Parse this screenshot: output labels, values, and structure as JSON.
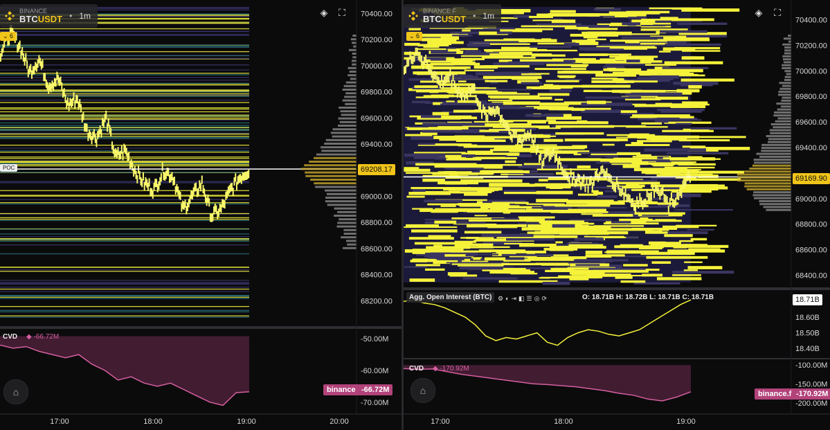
{
  "left_panel": {
    "exchange": "BINANCE",
    "symbol_base": "BTC",
    "symbol_quote": "USDT",
    "timeframe": "1m",
    "indicator_count": "6",
    "poc_label": "POC",
    "current_price": "69208.17",
    "cvd_label": "CVD",
    "cvd_value": "-66.72M",
    "cvd_exchange_tag": "binance",
    "cvd_current": "-66.72M",
    "colors": {
      "heat": "#f5f23a",
      "price_tag": "#f0c419",
      "cvd": "#b2437a"
    }
  },
  "right_panel": {
    "exchange": "BINANCE F",
    "symbol_base": "BTC",
    "symbol_quote": "USDT",
    "timeframe": "1m",
    "indicator_count": "6",
    "current_price": "69169.90",
    "oi_label": "Agg. Open Interest (BTC)",
    "oi_ohlc": "O: 18.71B  H: 18.72B  L: 18.71B  C: 18.71B",
    "oi_current": "18.71B",
    "cvd_label": "CVD",
    "cvd_value": "-170.92M",
    "cvd_exchange_tag": "binance.f",
    "cvd_current": "-170.92M"
  },
  "chart_data": [
    {
      "type": "heatmap",
      "title": "BINANCE BTCUSDT 1m",
      "y_ticks": [
        "70400.00",
        "70200.00",
        "70000.00",
        "69800.00",
        "69600.00",
        "69400.00",
        "69000.00",
        "68800.00",
        "68600.00",
        "68400.00",
        "68200.00"
      ],
      "ylim": [
        68000,
        70450
      ],
      "x_ticks": [
        "17:00",
        "18:00",
        "19:00",
        "20:00"
      ],
      "price_series": [
        70100,
        70250,
        70150,
        69950,
        70050,
        69850,
        69900,
        69700,
        69750,
        69500,
        69450,
        69600,
        69300,
        69350,
        69200,
        69100,
        69050,
        69200,
        69150,
        68900,
        69000,
        69100,
        68850,
        68900,
        69050,
        69150,
        69208.17
      ],
      "poc": 69208.17,
      "cvd": {
        "y_ticks": [
          "-50.00M",
          "-60.00M",
          "-70.00M"
        ],
        "ylim": [
          -72,
          -48
        ],
        "values": [
          -52,
          -53,
          -52.5,
          -54,
          -55,
          -56,
          -55,
          -58,
          -60,
          -63,
          -62,
          -64,
          -65,
          -64,
          -66,
          -68,
          -70,
          -71,
          -67,
          -66.72
        ]
      }
    },
    {
      "type": "heatmap",
      "title": "BINANCE F BTCUSDT 1m",
      "y_ticks": [
        "70400.00",
        "70200.00",
        "70000.00",
        "69800.00",
        "69600.00",
        "69400.00",
        "69000.00",
        "68800.00",
        "68600.00",
        "68400.00"
      ],
      "ylim": [
        68300,
        70500
      ],
      "x_ticks": [
        "17:00",
        "18:00",
        "19:00"
      ],
      "price_series": [
        70000,
        70150,
        70050,
        69900,
        69950,
        69800,
        69850,
        69650,
        69700,
        69550,
        69450,
        69500,
        69300,
        69350,
        69200,
        69150,
        69100,
        69200,
        69150,
        69050,
        68950,
        69000,
        69100,
        68950,
        69050,
        69169.9
      ],
      "poc": 69169.9,
      "open_interest": {
        "y_ticks": [
          "18.60B",
          "18.50B",
          "18.40B"
        ],
        "ylim": [
          18.37,
          18.75
        ],
        "values": [
          18.7,
          18.71,
          18.69,
          18.68,
          18.66,
          18.63,
          18.6,
          18.55,
          18.48,
          18.45,
          18.47,
          18.46,
          18.48,
          18.5,
          18.44,
          18.42,
          18.47,
          18.5,
          18.52,
          18.51,
          18.49,
          18.48,
          18.5,
          18.52,
          18.56,
          18.6,
          18.64,
          18.68,
          18.71
        ]
      },
      "cvd": {
        "y_ticks": [
          "-100.00M",
          "-150.00M",
          "-200.00M"
        ],
        "ylim": [
          -215,
          -95
        ],
        "values": [
          -110,
          -112,
          -111,
          -118,
          -125,
          -130,
          -135,
          -140,
          -145,
          -150,
          -152,
          -155,
          -158,
          -163,
          -168,
          -175,
          -180,
          -190,
          -195,
          -185,
          -170.92
        ]
      }
    }
  ]
}
